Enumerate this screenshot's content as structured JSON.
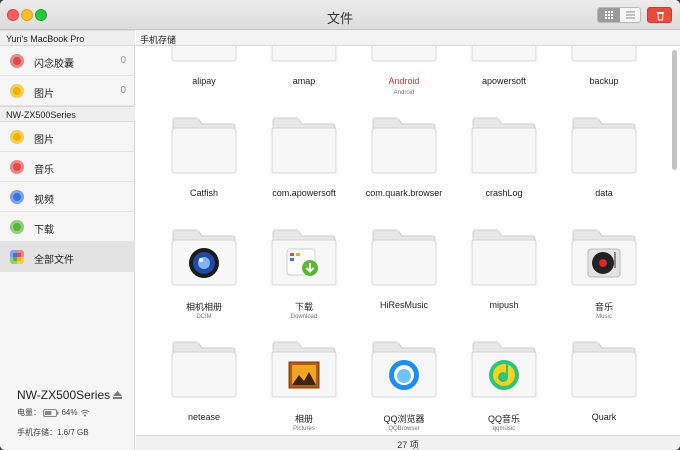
{
  "window": {
    "title": "文件",
    "item_count": "27 项"
  },
  "sidebar": {
    "sections": [
      {
        "header": "Yuri's MacBook Pro",
        "items": [
          {
            "label": "闪念胶囊",
            "count": "0",
            "icon": "capsule-icon",
            "color": "#d74b4b"
          },
          {
            "label": "图片",
            "count": "0",
            "icon": "photos-icon",
            "color": "#f0b400"
          }
        ]
      },
      {
        "header": "NW-ZX500Series",
        "items": [
          {
            "label": "图片",
            "icon": "photos-icon",
            "color": "#f0b400"
          },
          {
            "label": "音乐",
            "icon": "music-icon",
            "color": "#e5484d"
          },
          {
            "label": "视频",
            "icon": "video-icon",
            "color": "#3b73e0"
          },
          {
            "label": "下载",
            "icon": "download-icon",
            "color": "#5bb536"
          },
          {
            "label": "全部文件",
            "icon": "all-files-icon",
            "color": "#8a8a8a",
            "selected": true
          }
        ]
      }
    ],
    "device": {
      "name": "NW-ZX500Series",
      "battery_label": "电量：",
      "battery_pct": "64%",
      "battery_level": 0.64,
      "storage": "手机存储：1.6/7 GB"
    }
  },
  "path": "手机存储",
  "files": [
    {
      "name": "alipay",
      "sub": ""
    },
    {
      "name": "amap",
      "sub": ""
    },
    {
      "name": "Android",
      "sub": "Android",
      "highlight": true,
      "badge": "android"
    },
    {
      "name": "apowersoft",
      "sub": ""
    },
    {
      "name": "backup",
      "sub": ""
    },
    {
      "name": "Catfish",
      "sub": ""
    },
    {
      "name": "com.apowersoft",
      "sub": ""
    },
    {
      "name": "com.quark.browser",
      "sub": ""
    },
    {
      "name": "crashLog",
      "sub": ""
    },
    {
      "name": "data",
      "sub": ""
    },
    {
      "name": "相机相册",
      "sub": "DCIM",
      "badge": "camera"
    },
    {
      "name": "下载",
      "sub": "Download",
      "badge": "download"
    },
    {
      "name": "HiResMusic",
      "sub": ""
    },
    {
      "name": "mipush",
      "sub": ""
    },
    {
      "name": "音乐",
      "sub": "Music",
      "badge": "music"
    },
    {
      "name": "netease",
      "sub": ""
    },
    {
      "name": "相册",
      "sub": "Pictures",
      "badge": "pictures"
    },
    {
      "name": "QQ浏览器",
      "sub": "QQBrowser",
      "badge": "qqbrowser"
    },
    {
      "name": "QQ音乐",
      "sub": "qqmusic",
      "badge": "qqmusic"
    },
    {
      "name": "Quark",
      "sub": ""
    }
  ],
  "colors": {
    "highlight_text": "#e8312f",
    "accent_delete": "#e84c3d"
  }
}
